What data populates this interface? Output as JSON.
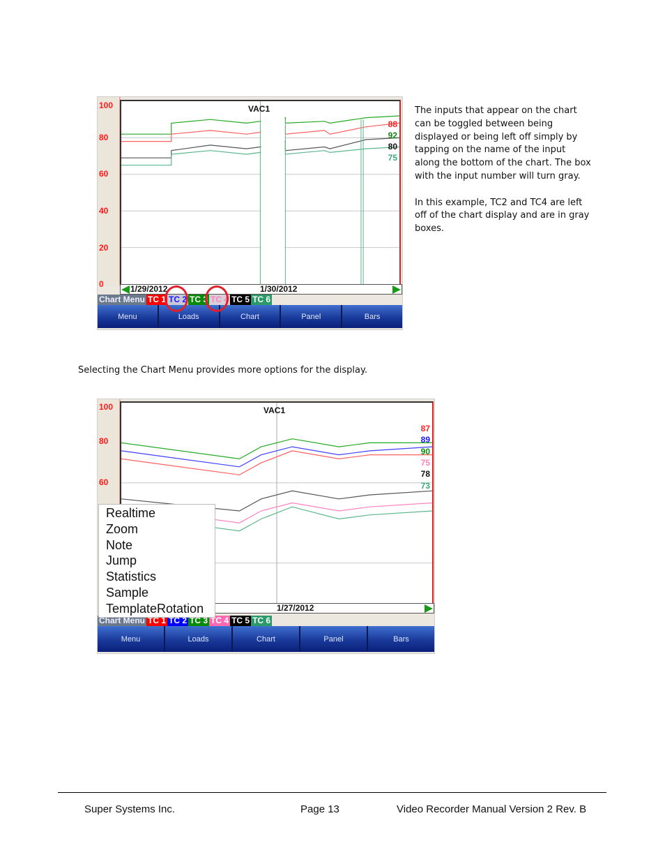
{
  "document": {
    "side_paragraphs": [
      "The inputs that appear on the chart can be toggled between being displayed or being left off simply by tapping on the name of the input along the bottom of the chart. The box with the input number will turn gray.",
      "In this example, TC2 and TC4 are left off of the chart display and are in gray boxes."
    ],
    "caption": "Selecting the Chart Menu provides more options for the display.",
    "footer": {
      "company": "Super Systems Inc.",
      "page": "Page 13",
      "manual": "Video Recorder Manual Version 2 Rev. B"
    }
  },
  "screen1": {
    "title": "VAC1",
    "y_ticks": [
      "100",
      "80",
      "60",
      "40",
      "20",
      "0"
    ],
    "dates": [
      "1/29/2012",
      "1/30/2012"
    ],
    "legend": {
      "chart_menu": "Chart Menu",
      "inputs": [
        {
          "label": "TC 1",
          "bg": "#ff0000",
          "fg": "#ffffff",
          "enabled": true
        },
        {
          "label": "TC 2",
          "bg": "#c8c8d8",
          "fg": "#1a1aff",
          "enabled": false
        },
        {
          "label": "TC 3",
          "bg": "#0a8a0a",
          "fg": "#ffffff",
          "enabled": true
        },
        {
          "label": "TC 4",
          "bg": "#d8d0d8",
          "fg": "#ff80c0",
          "enabled": false
        },
        {
          "label": "TC 5",
          "bg": "#000000",
          "fg": "#ffffff",
          "enabled": true
        },
        {
          "label": "TC 6",
          "bg": "#2a9a6a",
          "fg": "#ffffff",
          "enabled": true
        }
      ]
    },
    "end_values": [
      {
        "value": "88",
        "color": "#ff2020"
      },
      {
        "value": "92",
        "color": "#118811"
      },
      {
        "value": "80",
        "color": "#111111"
      },
      {
        "value": "75",
        "color": "#3aa878"
      }
    ],
    "nav": [
      "Menu",
      "Loads",
      "Chart",
      "Panel",
      "Bars"
    ]
  },
  "screen2": {
    "title": "VAC1",
    "y_ticks": [
      "100",
      "80",
      "60"
    ],
    "dates": [
      "1/27/2012"
    ],
    "legend": {
      "chart_menu": "Chart Menu",
      "inputs": [
        {
          "label": "TC 1",
          "bg": "#ff0000",
          "fg": "#ffffff",
          "enabled": true
        },
        {
          "label": "TC 2",
          "bg": "#0000ff",
          "fg": "#ffffff",
          "enabled": true
        },
        {
          "label": "TC 3",
          "bg": "#0a8a0a",
          "fg": "#ffffff",
          "enabled": true
        },
        {
          "label": "TC 4",
          "bg": "#ff69b4",
          "fg": "#ffffff",
          "enabled": true
        },
        {
          "label": "TC 5",
          "bg": "#000000",
          "fg": "#ffffff",
          "enabled": true
        },
        {
          "label": "TC 6",
          "bg": "#2a9a6a",
          "fg": "#ffffff",
          "enabled": true
        }
      ]
    },
    "end_values": [
      {
        "value": "87",
        "color": "#ff2020"
      },
      {
        "value": "89",
        "color": "#1a1aff"
      },
      {
        "value": "90",
        "color": "#118811"
      },
      {
        "value": "75",
        "color": "#ff80c0"
      },
      {
        "value": "78",
        "color": "#111111"
      },
      {
        "value": "73",
        "color": "#3aa878"
      }
    ],
    "chart_menu_items": [
      "Realtime",
      "Zoom",
      "Note",
      "Jump",
      "Statistics",
      "Sample",
      "TemplateRotation"
    ],
    "nav": [
      "Menu",
      "Loads",
      "Chart",
      "Panel",
      "Bars"
    ]
  },
  "chart_data": [
    {
      "type": "line",
      "title": "VAC1",
      "xlabel": "",
      "ylabel": "",
      "ylim": [
        0,
        100
      ],
      "x_tick_labels": [
        "1/29/2012",
        "1/30/2012"
      ],
      "grid": true,
      "series": [
        {
          "name": "TC 3",
          "color": "#22aa22",
          "x": [
            0,
            0.18,
            0.18,
            0.32,
            0.45,
            0.5,
            0.57,
            0.59,
            0.59,
            0.73,
            0.75,
            0.88,
            1.0
          ],
          "values": [
            82,
            82,
            88,
            90,
            88,
            89,
            91,
            91,
            88,
            89,
            88,
            91,
            92
          ]
        },
        {
          "name": "TC 1",
          "color": "#ff6060",
          "x": [
            0,
            0.18,
            0.18,
            0.32,
            0.45,
            0.5,
            0.57,
            0.59,
            0.59,
            0.73,
            0.75,
            0.88,
            1.0
          ],
          "values": [
            78,
            78,
            82,
            84,
            82,
            83,
            86,
            86,
            82,
            84,
            82,
            86,
            88
          ]
        },
        {
          "name": "TC 5",
          "color": "#555555",
          "x": [
            0,
            0.18,
            0.18,
            0.32,
            0.45,
            0.5,
            0.57,
            0.59,
            0.59,
            0.73,
            0.75,
            0.88,
            1.0
          ],
          "values": [
            69,
            69,
            73,
            76,
            74,
            75,
            78,
            78,
            73,
            75,
            74,
            79,
            80
          ]
        },
        {
          "name": "TC 6",
          "color": "#5ab88a",
          "x": [
            0,
            0.18,
            0.18,
            0.32,
            0.45,
            0.5,
            0.57,
            0.59,
            0.59,
            0.73,
            0.75,
            0.88,
            1.0
          ],
          "values": [
            65,
            65,
            71,
            73,
            71,
            72,
            74,
            74,
            71,
            73,
            72,
            74,
            75
          ]
        }
      ]
    },
    {
      "type": "line",
      "title": "VAC1",
      "xlabel": "",
      "ylabel": "",
      "ylim": [
        50,
        100
      ],
      "x_tick_labels": [
        "1/27/2012"
      ],
      "grid": true,
      "series": [
        {
          "name": "TC 3",
          "color": "#22aa22",
          "x": [
            0,
            0.38,
            0.45,
            0.55,
            0.7,
            0.8,
            1.0
          ],
          "values": [
            90,
            86,
            89,
            91,
            89,
            90,
            90
          ]
        },
        {
          "name": "TC 2",
          "color": "#4040ff",
          "x": [
            0,
            0.38,
            0.45,
            0.55,
            0.7,
            0.8,
            1.0
          ],
          "values": [
            88,
            84,
            87,
            89,
            87,
            88,
            89
          ]
        },
        {
          "name": "TC 1",
          "color": "#ff6060",
          "x": [
            0,
            0.38,
            0.45,
            0.55,
            0.7,
            0.8,
            1.0
          ],
          "values": [
            86,
            82,
            85,
            88,
            86,
            87,
            87
          ]
        },
        {
          "name": "TC 5",
          "color": "#555555",
          "x": [
            0,
            0.38,
            0.45,
            0.55,
            0.7,
            0.8,
            1.0
          ],
          "values": [
            76,
            73,
            76,
            78,
            76,
            77,
            78
          ]
        },
        {
          "name": "TC 4",
          "color": "#ff80c0",
          "x": [
            0,
            0.38,
            0.45,
            0.55,
            0.7,
            0.8,
            1.0
          ],
          "values": [
            74,
            70,
            73,
            75,
            73,
            74,
            75
          ]
        },
        {
          "name": "TC 6",
          "color": "#5ab88a",
          "x": [
            0,
            0.38,
            0.45,
            0.55,
            0.7,
            0.8,
            1.0
          ],
          "values": [
            72,
            68,
            71,
            74,
            71,
            72,
            73
          ]
        }
      ]
    }
  ]
}
